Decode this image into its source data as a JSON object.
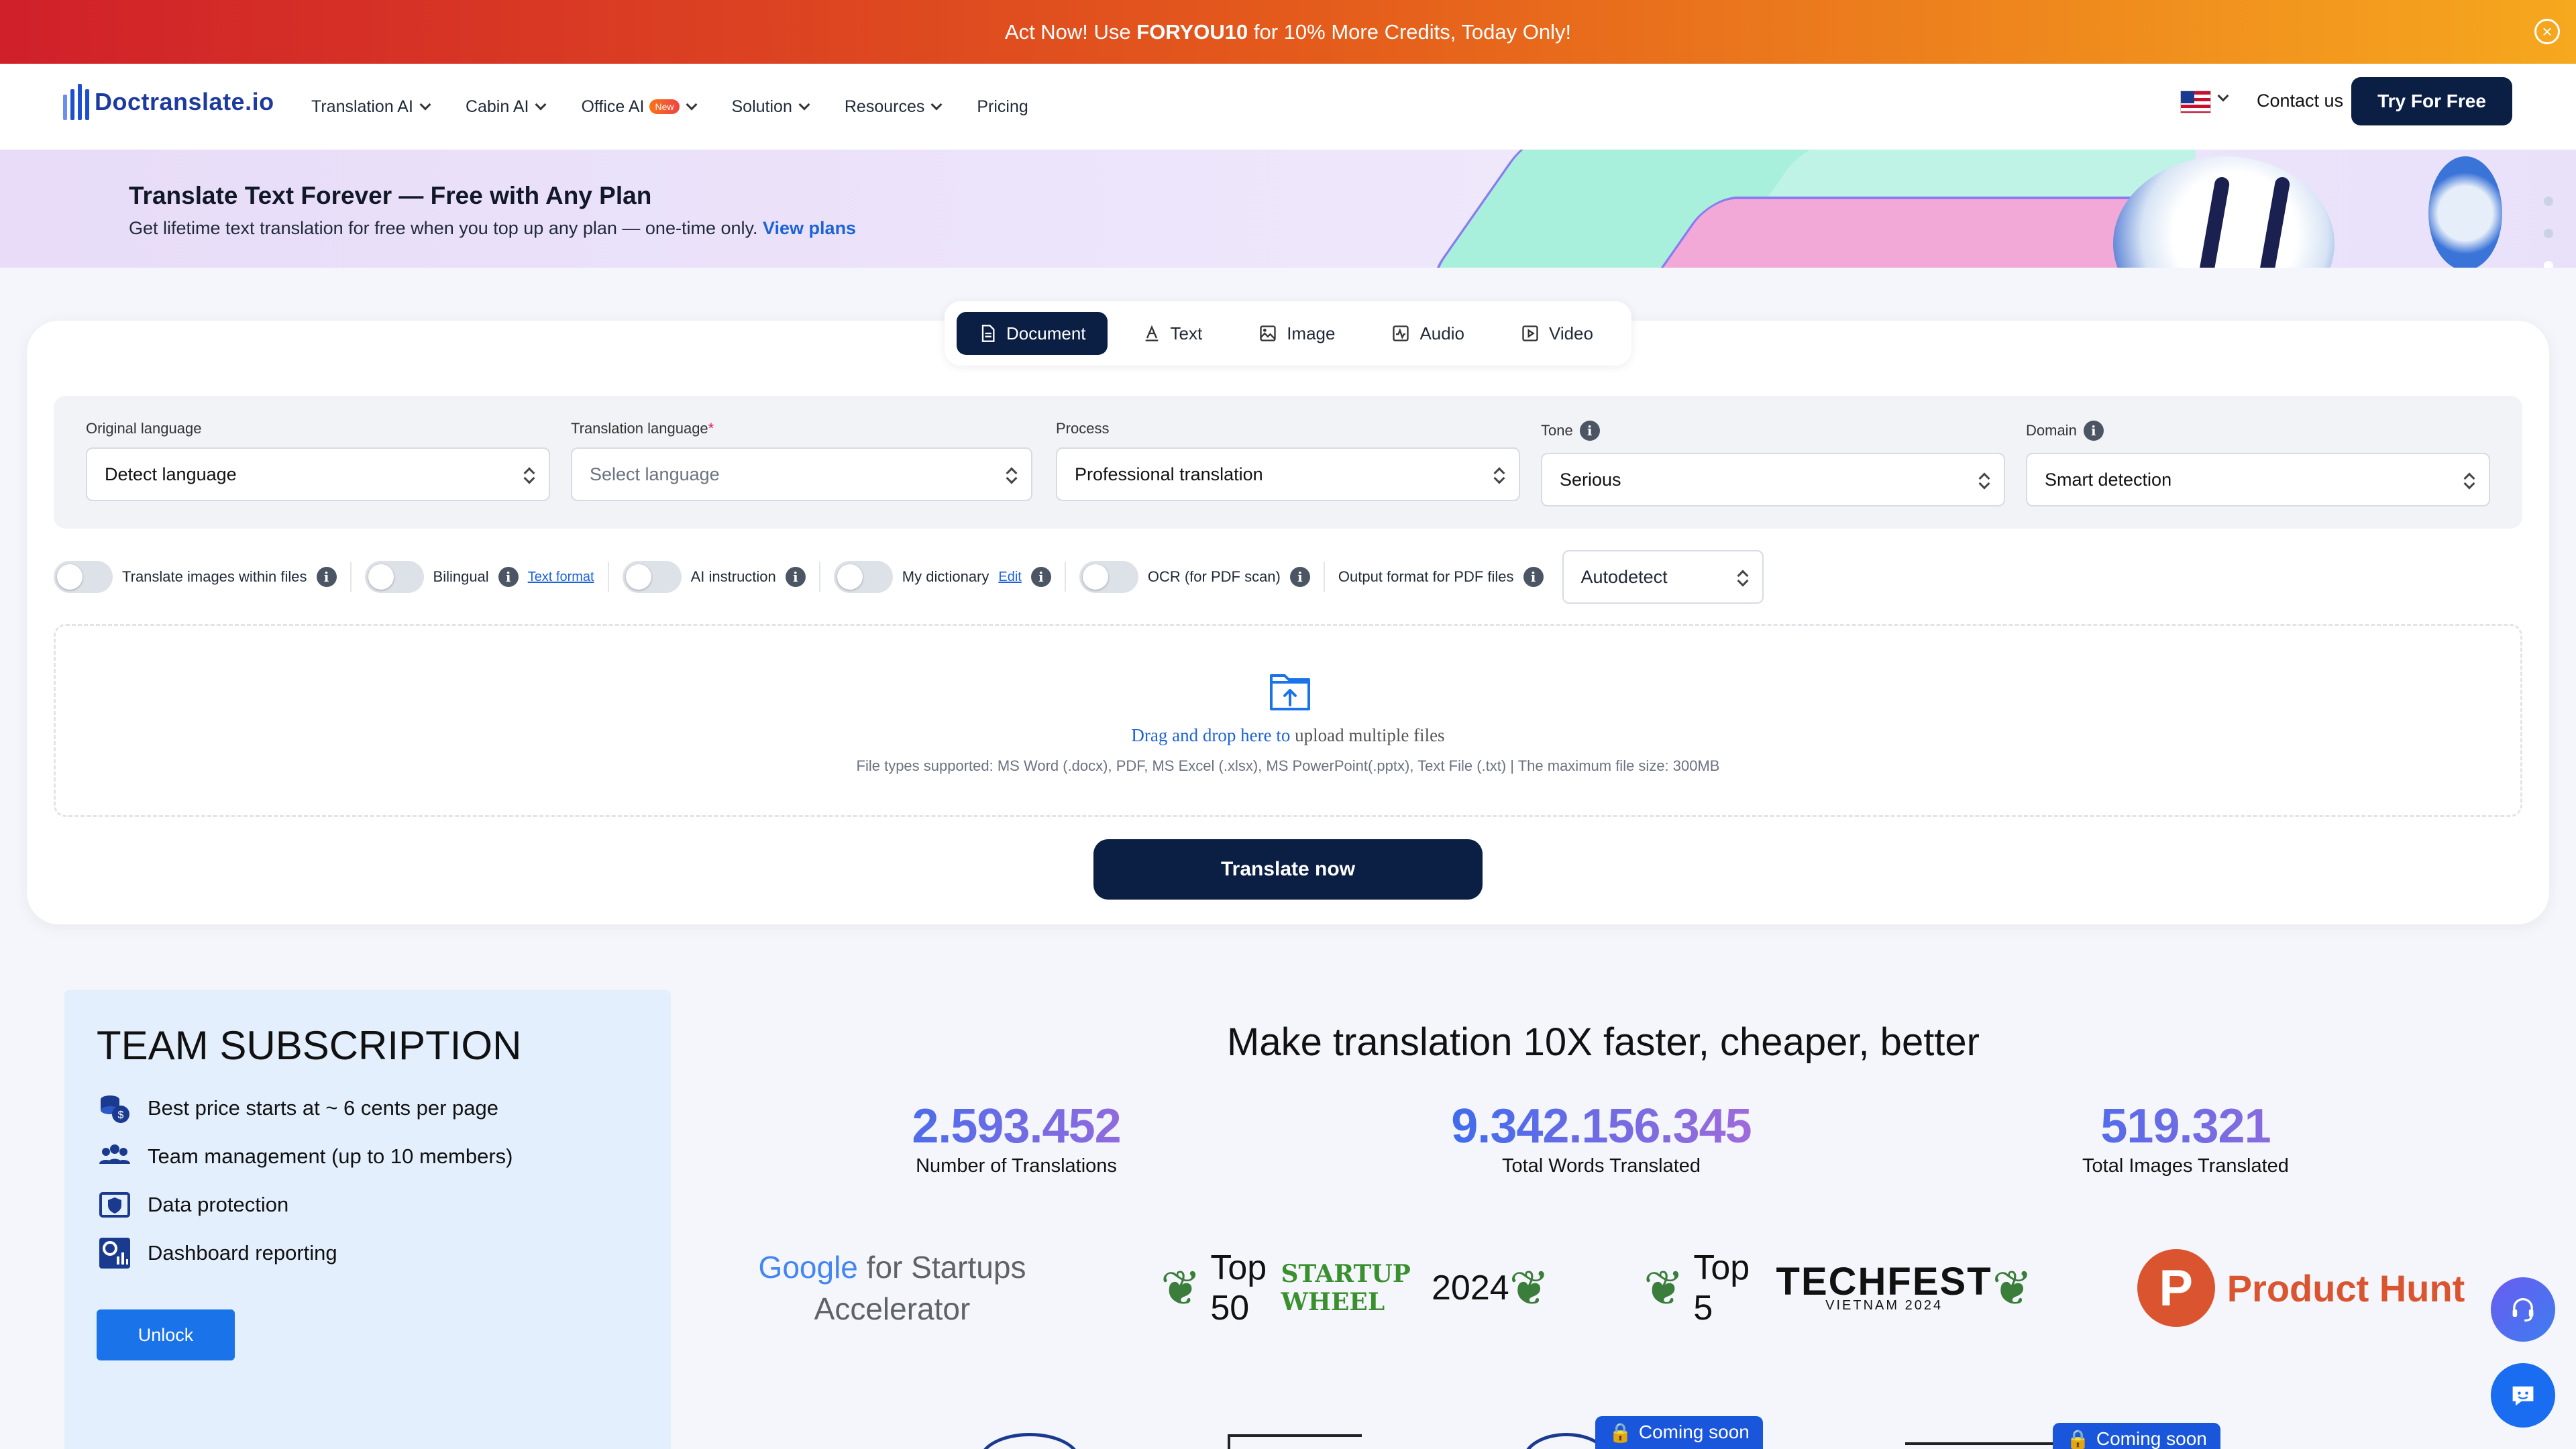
{
  "promo": {
    "prefix": "Act Now! Use ",
    "code": "FORYOU10",
    "suffix": " for 10% More Credits, Today Only!"
  },
  "nav": {
    "logo": "Doctranslate.io",
    "menu": [
      {
        "label": "Translation AI",
        "dropdown": true
      },
      {
        "label": "Cabin AI",
        "dropdown": true
      },
      {
        "label": "Office AI",
        "dropdown": true,
        "badge": "New"
      },
      {
        "label": "Solution",
        "dropdown": true
      },
      {
        "label": "Resources",
        "dropdown": true
      },
      {
        "label": "Pricing",
        "dropdown": false
      }
    ],
    "contact": "Contact us",
    "cta": "Try For Free"
  },
  "hero": {
    "title": "Translate Text Forever — Free with Any Plan",
    "subtitle": "Get lifetime text translation for free when you top up any plan — one-time only.",
    "link": "View plans"
  },
  "tabs": [
    "Document",
    "Text",
    "Image",
    "Audio",
    "Video"
  ],
  "active_tab": "Document",
  "fields": {
    "original": {
      "label": "Original language",
      "value": "Detect language"
    },
    "target": {
      "label": "Translation language",
      "required": "*",
      "placeholder": "Select language"
    },
    "process": {
      "label": "Process",
      "value": "Professional translation"
    },
    "tone": {
      "label": "Tone",
      "value": "Serious"
    },
    "domain": {
      "label": "Domain",
      "value": "Smart detection"
    }
  },
  "options": {
    "translate_images": "Translate images within files",
    "bilingual": "Bilingual",
    "text_format": "Text format",
    "ai_instruction": "AI instruction",
    "my_dictionary": "My dictionary",
    "edit": "Edit",
    "ocr": "OCR (for PDF scan)",
    "output_format_label": "Output format for PDF files",
    "output_format_value": "Autodetect"
  },
  "dropzone": {
    "drag": "Drag and drop here to",
    "upload": " upload multiple files",
    "note": "File types supported: MS Word (.docx), PDF, MS Excel (.xlsx), MS PowerPoint(.pptx), Text File (.txt) | The maximum file size: 300MB"
  },
  "translate_button": "Translate now",
  "team": {
    "title": "TEAM SUBSCRIPTION",
    "items": [
      {
        "icon": "coins-icon",
        "label": "Best price starts at ~ 6 cents per page"
      },
      {
        "icon": "team-icon",
        "label": "Team management (up to 10 members)"
      },
      {
        "icon": "shield-icon",
        "label": "Data protection"
      },
      {
        "icon": "dashboard-icon",
        "label": "Dashboard reporting"
      }
    ],
    "unlock": "Unlock"
  },
  "stats": {
    "title": "Make translation 10X faster, cheaper, better",
    "items": [
      {
        "value": "2.593.452",
        "label": "Number of Translations"
      },
      {
        "value": "9.342.156.345",
        "label": "Total Words Translated"
      },
      {
        "value": "519.321",
        "label": "Total Images Translated"
      }
    ]
  },
  "awards": {
    "google": {
      "brand": "Google",
      "rest": " for Startups",
      "line2": "Accelerator"
    },
    "startup_wheel": {
      "prefix": "Top 50",
      "brand": "STARTUP WHEEL",
      "year": "2024"
    },
    "techfest": {
      "prefix": "Top 5",
      "brand": "TECHFEST",
      "sub": "VIETNAM 2024"
    },
    "product_hunt": {
      "letter": "P",
      "name": "Product Hunt"
    }
  },
  "coming_soon": "Coming soon",
  "colors": {
    "primary_dark": "#0b1f44",
    "accent_blue": "#1a73e8",
    "promo_start": "#d0202a",
    "promo_end": "#f6a81e"
  }
}
